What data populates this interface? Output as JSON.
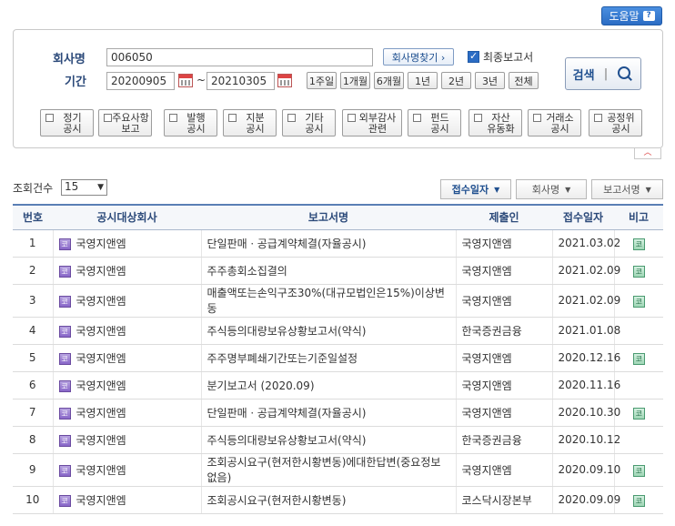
{
  "help_label": "도움말",
  "help_icon": "?",
  "search": {
    "company_label": "회사명",
    "company_value": "006050",
    "find_company_label": "회사명찾기 ›",
    "final_report_checked": true,
    "final_report_label": "최종보고서",
    "period_label": "기간",
    "start_date": "20200905",
    "end_date": "20210305",
    "period_sep": "~",
    "periods": [
      "1주일",
      "1개월",
      "6개월",
      "1년",
      "2년",
      "3년",
      "전체"
    ],
    "search_label": "검색",
    "categories": [
      "정기\n공시",
      "주요사항\n보고",
      "발행\n공시",
      "지분\n공시",
      "기타\n공시",
      "외부감사\n관련",
      "펀드\n공시",
      "자산\n유동화",
      "거래소\n공시",
      "공정위\n공시"
    ]
  },
  "list": {
    "count_label": "조회건수",
    "count_value": "15",
    "sort": [
      "접수일자",
      "회사명",
      "보고서명"
    ],
    "columns": [
      "번호",
      "공시대상회사",
      "보고서명",
      "제출인",
      "접수일자",
      "비고"
    ],
    "corp_icon": "코",
    "remark_icon": "코",
    "rows": [
      {
        "no": "1",
        "company": "국영지앤엠",
        "report": "단일판매ㆍ공급계약체결(자율공시)",
        "submitter": "국영지앤엠",
        "date": "2021.03.02",
        "remark": true
      },
      {
        "no": "2",
        "company": "국영지앤엠",
        "report": "주주총회소집결의",
        "submitter": "국영지앤엠",
        "date": "2021.02.09",
        "remark": true
      },
      {
        "no": "3",
        "company": "국영지앤엠",
        "report": "매출액또는손익구조30%(대규모법인은15%)이상변동",
        "submitter": "국영지앤엠",
        "date": "2021.02.09",
        "remark": true
      },
      {
        "no": "4",
        "company": "국영지앤엠",
        "report": "주식등의대량보유상황보고서(약식)",
        "submitter": "한국증권금융",
        "date": "2021.01.08",
        "remark": false
      },
      {
        "no": "5",
        "company": "국영지앤엠",
        "report": "주주명부폐쇄기간또는기준일설정",
        "submitter": "국영지앤엠",
        "date": "2020.12.16",
        "remark": true
      },
      {
        "no": "6",
        "company": "국영지앤엠",
        "report": "분기보고서 (2020.09)",
        "submitter": "국영지앤엠",
        "date": "2020.11.16",
        "remark": false
      },
      {
        "no": "7",
        "company": "국영지앤엠",
        "report": "단일판매ㆍ공급계약체결(자율공시)",
        "submitter": "국영지앤엠",
        "date": "2020.10.30",
        "remark": true
      },
      {
        "no": "8",
        "company": "국영지앤엠",
        "report": "주식등의대량보유상황보고서(약식)",
        "submitter": "한국증권금융",
        "date": "2020.10.12",
        "remark": false
      },
      {
        "no": "9",
        "company": "국영지앤엠",
        "report": "조회공시요구(현저한시황변동)에대한답변(중요정보없음)",
        "submitter": "국영지앤엠",
        "date": "2020.09.10",
        "remark": true
      },
      {
        "no": "10",
        "company": "국영지앤엠",
        "report": "조회공시요구(현저한시황변동)",
        "submitter": "코스닥시장본부",
        "date": "2020.09.09",
        "remark": true
      }
    ]
  }
}
